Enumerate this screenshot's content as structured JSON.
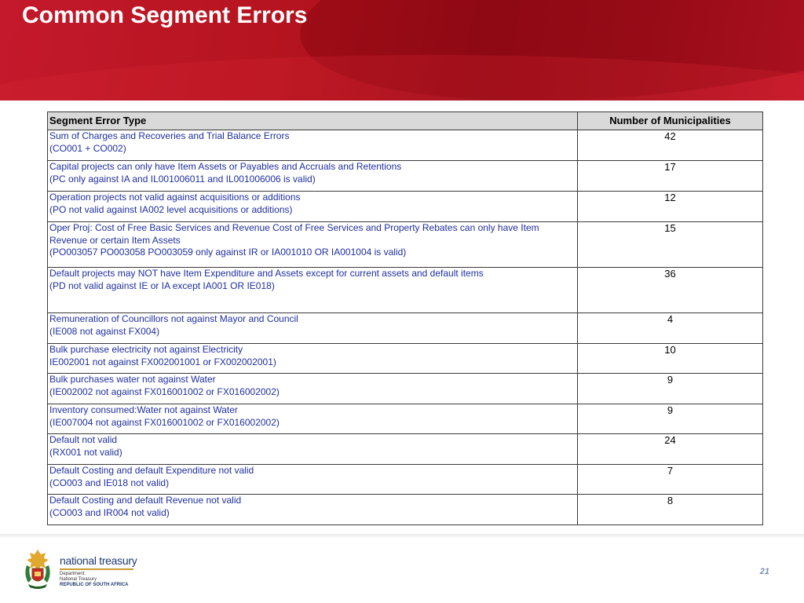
{
  "slide": {
    "title": "Common Segment Errors",
    "page_number": "21"
  },
  "table": {
    "headers": {
      "type": "Segment Error Type",
      "count": "Number of Municipalities"
    },
    "rows": [
      {
        "lines": [
          "Sum of Charges and Recoveries and Trial Balance Errors",
          "(CO001 + CO002)"
        ],
        "count": "42"
      },
      {
        "lines": [
          "Capital projects can only have Item Assets or Payables and Accruals and Retentions",
          "(PC only against IA and IL001006011 and IL001006006 is valid)"
        ],
        "count": "17"
      },
      {
        "lines": [
          "Operation projects not valid against acquisitions or additions",
          "(PO not valid against IA002 level acquisitions or additions)"
        ],
        "count": "12"
      },
      {
        "lines": [
          "Oper Proj: Cost of Free Basic Services and Revenue Cost of Free Services and Property Rebates can only have Item Revenue or certain Item Assets",
          "(PO003057 PO003058 PO003059 only against IR or IA001010 OR IA001004 is valid)"
        ],
        "count": "15"
      },
      {
        "lines": [
          "Default projects may NOT have Item Expenditure and Assets except for current assets and default items",
          "(PD not valid against IE or IA except IA001 OR IE018)"
        ],
        "count": "36"
      },
      {
        "lines": [
          "Remuneration of Councillors not against Mayor and Council",
          "(IE008 not against FX004)"
        ],
        "count": "4"
      },
      {
        "lines": [
          "Bulk purchase electricity not against Electricity",
          "IE002001 not against FX002001001 or FX002002001)"
        ],
        "count": "10"
      },
      {
        "lines": [
          "Bulk purchases water not against Water",
          "(IE002002 not against FX016001002 or FX016002002)"
        ],
        "count": "9"
      },
      {
        "lines": [
          "Inventory consumed:Water not against Water",
          "(IE007004 not against FX016001002 or FX016002002)"
        ],
        "count": "9"
      },
      {
        "lines": [
          "Default not valid",
          "(RX001 not valid)"
        ],
        "count": "24"
      },
      {
        "lines": [
          "Default Costing and default Expenditure not valid",
          "(CO003 and IE018 not valid)"
        ],
        "count": "7"
      },
      {
        "lines": [
          "Default Costing and default Revenue not valid",
          "(CO003 and IR004 not valid)"
        ],
        "count": "8"
      }
    ]
  },
  "logo": {
    "name": "national treasury",
    "line1": "Department:",
    "line2": "National Treasury",
    "line3": "REPUBLIC OF SOUTH AFRICA",
    "icon": "coat-of-arms-icon"
  },
  "colors": {
    "header_red": "#b5141f",
    "description_text": "#1f2fa0",
    "header_cell_bg": "#d9d9d9"
  }
}
